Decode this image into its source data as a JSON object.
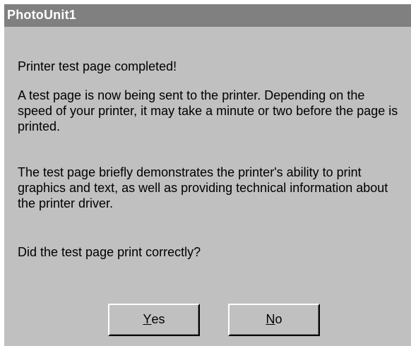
{
  "window": {
    "title": "PhotoUnit1"
  },
  "dialog": {
    "heading": "Printer test page completed!",
    "paragraph_1": "A test page is now being sent to the printer. Depending on the speed of your printer, it may take a minute or two before the page is printed.",
    "paragraph_2": "The test page briefly demonstrates the printer's ability to print graphics and text, as well as providing technical information about the printer driver.",
    "question": "Did the test page print correctly?"
  },
  "buttons": {
    "yes": {
      "mnemonic": "Y",
      "rest": "es"
    },
    "no": {
      "mnemonic": "N",
      "rest": "o"
    }
  },
  "colors": {
    "titlebar": "#808080",
    "face": "#c0c0c0",
    "title_text": "#ffffff"
  }
}
